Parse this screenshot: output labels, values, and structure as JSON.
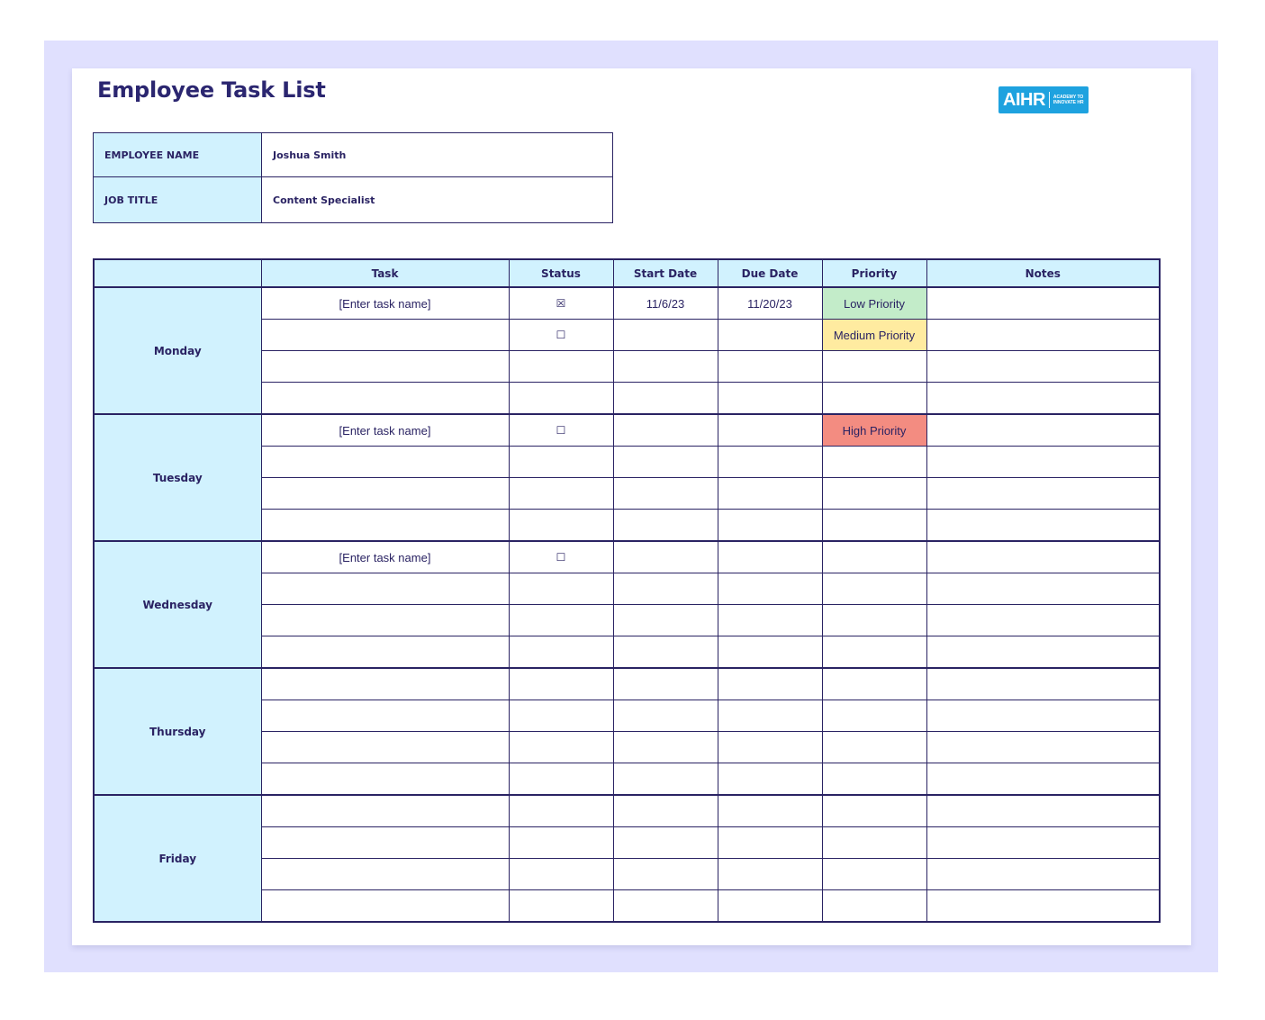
{
  "document": {
    "title": "Employee Task List",
    "logo": {
      "mark": "AIHR",
      "tagline": "ACADEMY TO INNOVATE HR",
      "color": "#1ea2df"
    }
  },
  "employee": {
    "name_label": "EMPLOYEE NAME",
    "name_value": "Joshua Smith",
    "title_label": "JOB TITLE",
    "title_value": "Content Specialist"
  },
  "table": {
    "headers": {
      "day": "",
      "task": "Task",
      "status": "Status",
      "start": "Start Date",
      "due": "Due Date",
      "priority": "Priority",
      "notes": "Notes"
    },
    "days": [
      {
        "name": "Monday",
        "rows": [
          {
            "task": "[Enter task name]",
            "status": "☒",
            "start": "11/6/23",
            "due": "11/20/23",
            "priority": "Low Priority",
            "notes": ""
          },
          {
            "task": "",
            "status": "☐",
            "start": "",
            "due": "",
            "priority": "Medium Priority",
            "notes": ""
          },
          {
            "task": "",
            "status": "",
            "start": "",
            "due": "",
            "priority": "",
            "notes": ""
          },
          {
            "task": "",
            "status": "",
            "start": "",
            "due": "",
            "priority": "",
            "notes": ""
          }
        ]
      },
      {
        "name": "Tuesday",
        "rows": [
          {
            "task": "[Enter task name]",
            "status": "☐",
            "start": "",
            "due": "",
            "priority": "High Priority",
            "notes": ""
          },
          {
            "task": "",
            "status": "",
            "start": "",
            "due": "",
            "priority": "",
            "notes": ""
          },
          {
            "task": "",
            "status": "",
            "start": "",
            "due": "",
            "priority": "",
            "notes": ""
          },
          {
            "task": "",
            "status": "",
            "start": "",
            "due": "",
            "priority": "",
            "notes": ""
          }
        ]
      },
      {
        "name": "Wednesday",
        "rows": [
          {
            "task": "[Enter task name]",
            "status": "☐",
            "start": "",
            "due": "",
            "priority": "",
            "notes": ""
          },
          {
            "task": "",
            "status": "",
            "start": "",
            "due": "",
            "priority": "",
            "notes": ""
          },
          {
            "task": "",
            "status": "",
            "start": "",
            "due": "",
            "priority": "",
            "notes": ""
          },
          {
            "task": "",
            "status": "",
            "start": "",
            "due": "",
            "priority": "",
            "notes": ""
          }
        ]
      },
      {
        "name": "Thursday",
        "rows": [
          {
            "task": "",
            "status": "",
            "start": "",
            "due": "",
            "priority": "",
            "notes": ""
          },
          {
            "task": "",
            "status": "",
            "start": "",
            "due": "",
            "priority": "",
            "notes": ""
          },
          {
            "task": "",
            "status": "",
            "start": "",
            "due": "",
            "priority": "",
            "notes": ""
          },
          {
            "task": "",
            "status": "",
            "start": "",
            "due": "",
            "priority": "",
            "notes": ""
          }
        ]
      },
      {
        "name": "Friday",
        "rows": [
          {
            "task": "",
            "status": "",
            "start": "",
            "due": "",
            "priority": "",
            "notes": ""
          },
          {
            "task": "",
            "status": "",
            "start": "",
            "due": "",
            "priority": "",
            "notes": ""
          },
          {
            "task": "",
            "status": "",
            "start": "",
            "due": "",
            "priority": "",
            "notes": ""
          },
          {
            "task": "",
            "status": "",
            "start": "",
            "due": "",
            "priority": "",
            "notes": ""
          }
        ]
      }
    ],
    "priority_colors": {
      "Low Priority": "#c3ecc9",
      "Medium Priority": "#ffeba0",
      "High Priority": "#f38c81"
    }
  }
}
